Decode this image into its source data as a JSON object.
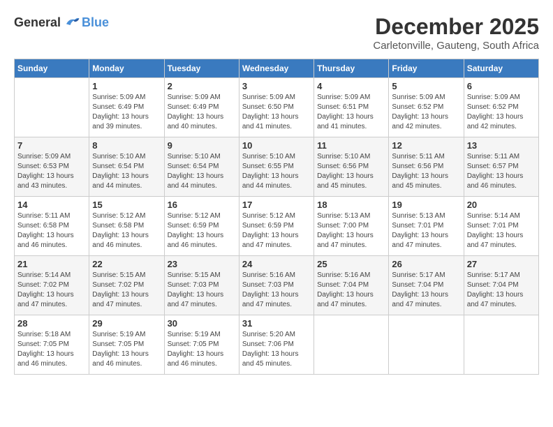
{
  "logo": {
    "general": "General",
    "blue": "Blue"
  },
  "title": {
    "month": "December 2025",
    "location": "Carletonville, Gauteng, South Africa"
  },
  "headers": [
    "Sunday",
    "Monday",
    "Tuesday",
    "Wednesday",
    "Thursday",
    "Friday",
    "Saturday"
  ],
  "weeks": [
    [
      {
        "day": "",
        "empty": true
      },
      {
        "day": "1",
        "sunrise": "5:09 AM",
        "sunset": "6:49 PM",
        "daylight": "13 hours and 39 minutes."
      },
      {
        "day": "2",
        "sunrise": "5:09 AM",
        "sunset": "6:49 PM",
        "daylight": "13 hours and 40 minutes."
      },
      {
        "day": "3",
        "sunrise": "5:09 AM",
        "sunset": "6:50 PM",
        "daylight": "13 hours and 41 minutes."
      },
      {
        "day": "4",
        "sunrise": "5:09 AM",
        "sunset": "6:51 PM",
        "daylight": "13 hours and 41 minutes."
      },
      {
        "day": "5",
        "sunrise": "5:09 AM",
        "sunset": "6:52 PM",
        "daylight": "13 hours and 42 minutes."
      },
      {
        "day": "6",
        "sunrise": "5:09 AM",
        "sunset": "6:52 PM",
        "daylight": "13 hours and 42 minutes."
      }
    ],
    [
      {
        "day": "7",
        "sunrise": "5:09 AM",
        "sunset": "6:53 PM",
        "daylight": "13 hours and 43 minutes."
      },
      {
        "day": "8",
        "sunrise": "5:10 AM",
        "sunset": "6:54 PM",
        "daylight": "13 hours and 44 minutes."
      },
      {
        "day": "9",
        "sunrise": "5:10 AM",
        "sunset": "6:54 PM",
        "daylight": "13 hours and 44 minutes."
      },
      {
        "day": "10",
        "sunrise": "5:10 AM",
        "sunset": "6:55 PM",
        "daylight": "13 hours and 44 minutes."
      },
      {
        "day": "11",
        "sunrise": "5:10 AM",
        "sunset": "6:56 PM",
        "daylight": "13 hours and 45 minutes."
      },
      {
        "day": "12",
        "sunrise": "5:11 AM",
        "sunset": "6:56 PM",
        "daylight": "13 hours and 45 minutes."
      },
      {
        "day": "13",
        "sunrise": "5:11 AM",
        "sunset": "6:57 PM",
        "daylight": "13 hours and 46 minutes."
      }
    ],
    [
      {
        "day": "14",
        "sunrise": "5:11 AM",
        "sunset": "6:58 PM",
        "daylight": "13 hours and 46 minutes."
      },
      {
        "day": "15",
        "sunrise": "5:12 AM",
        "sunset": "6:58 PM",
        "daylight": "13 hours and 46 minutes."
      },
      {
        "day": "16",
        "sunrise": "5:12 AM",
        "sunset": "6:59 PM",
        "daylight": "13 hours and 46 minutes."
      },
      {
        "day": "17",
        "sunrise": "5:12 AM",
        "sunset": "6:59 PM",
        "daylight": "13 hours and 47 minutes."
      },
      {
        "day": "18",
        "sunrise": "5:13 AM",
        "sunset": "7:00 PM",
        "daylight": "13 hours and 47 minutes."
      },
      {
        "day": "19",
        "sunrise": "5:13 AM",
        "sunset": "7:01 PM",
        "daylight": "13 hours and 47 minutes."
      },
      {
        "day": "20",
        "sunrise": "5:14 AM",
        "sunset": "7:01 PM",
        "daylight": "13 hours and 47 minutes."
      }
    ],
    [
      {
        "day": "21",
        "sunrise": "5:14 AM",
        "sunset": "7:02 PM",
        "daylight": "13 hours and 47 minutes."
      },
      {
        "day": "22",
        "sunrise": "5:15 AM",
        "sunset": "7:02 PM",
        "daylight": "13 hours and 47 minutes."
      },
      {
        "day": "23",
        "sunrise": "5:15 AM",
        "sunset": "7:03 PM",
        "daylight": "13 hours and 47 minutes."
      },
      {
        "day": "24",
        "sunrise": "5:16 AM",
        "sunset": "7:03 PM",
        "daylight": "13 hours and 47 minutes."
      },
      {
        "day": "25",
        "sunrise": "5:16 AM",
        "sunset": "7:04 PM",
        "daylight": "13 hours and 47 minutes."
      },
      {
        "day": "26",
        "sunrise": "5:17 AM",
        "sunset": "7:04 PM",
        "daylight": "13 hours and 47 minutes."
      },
      {
        "day": "27",
        "sunrise": "5:17 AM",
        "sunset": "7:04 PM",
        "daylight": "13 hours and 47 minutes."
      }
    ],
    [
      {
        "day": "28",
        "sunrise": "5:18 AM",
        "sunset": "7:05 PM",
        "daylight": "13 hours and 46 minutes."
      },
      {
        "day": "29",
        "sunrise": "5:19 AM",
        "sunset": "7:05 PM",
        "daylight": "13 hours and 46 minutes."
      },
      {
        "day": "30",
        "sunrise": "5:19 AM",
        "sunset": "7:05 PM",
        "daylight": "13 hours and 46 minutes."
      },
      {
        "day": "31",
        "sunrise": "5:20 AM",
        "sunset": "7:06 PM",
        "daylight": "13 hours and 45 minutes."
      },
      {
        "day": "",
        "empty": true
      },
      {
        "day": "",
        "empty": true
      },
      {
        "day": "",
        "empty": true
      }
    ]
  ],
  "labels": {
    "sunrise": "Sunrise:",
    "sunset": "Sunset:",
    "daylight": "Daylight:"
  }
}
